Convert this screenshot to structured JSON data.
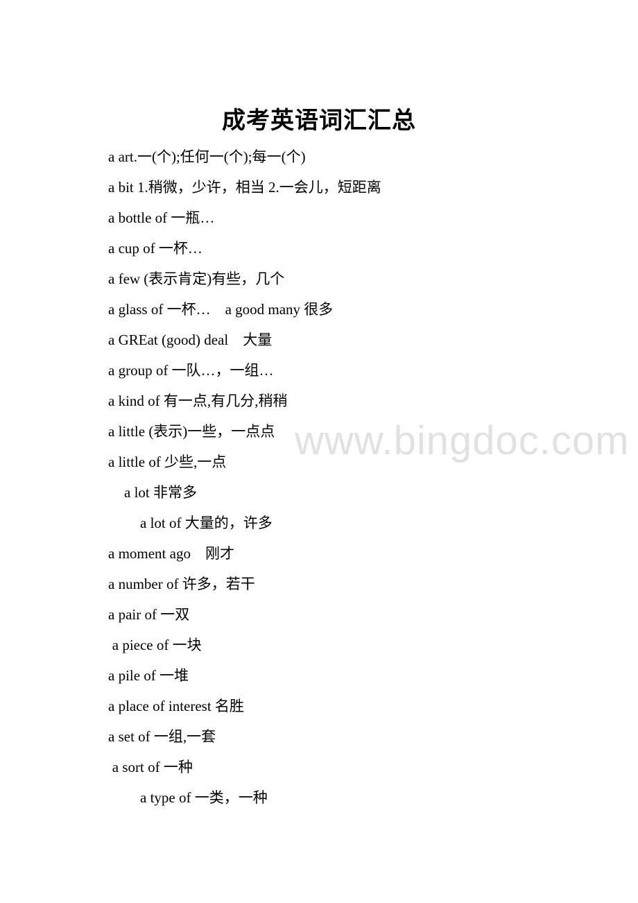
{
  "document": {
    "title": "成考英语词汇汇总",
    "entries": [
      {
        "text": "a art.一(个);任何一(个);每一(个)",
        "indent": 0
      },
      {
        "text": "a bit 1.稍微，少许，相当 2.一会儿，短距离",
        "indent": 0
      },
      {
        "text": "a bottle of 一瓶…",
        "indent": 0
      },
      {
        "text": "a cup of 一杯…",
        "indent": 0
      },
      {
        "text": "a few (表示肯定)有些，几个",
        "indent": 0
      },
      {
        "text": "a glass of 一杯…    a good many 很多",
        "indent": 0
      },
      {
        "text": "a GREat (good) deal    大量",
        "indent": 0
      },
      {
        "text": "a group of 一队…，一组…",
        "indent": 0
      },
      {
        "text": "a kind of 有一点,有几分,稍稍",
        "indent": 0
      },
      {
        "text": "a little (表示)一些，一点点",
        "indent": 0
      },
      {
        "text": "a little of 少些,一点",
        "indent": 0
      },
      {
        "text": "a lot 非常多",
        "indent": 1
      },
      {
        "text": "a lot of 大量的，许多",
        "indent": 2
      },
      {
        "text": "a moment ago    刚才",
        "indent": 0
      },
      {
        "text": "a number of 许多，若干",
        "indent": 0
      },
      {
        "text": "a pair of 一双",
        "indent": 0
      },
      {
        "text": "a piece of 一块",
        "indent": 0.25
      },
      {
        "text": "a pile of 一堆",
        "indent": 0
      },
      {
        "text": "a place of interest 名胜",
        "indent": 0
      },
      {
        "text": "a set of 一组,一套",
        "indent": 0
      },
      {
        "text": "a sort of 一种",
        "indent": 0.25
      },
      {
        "text": "a type of 一类，一种",
        "indent": 2
      }
    ]
  },
  "watermark": "www.bingdoc.com"
}
